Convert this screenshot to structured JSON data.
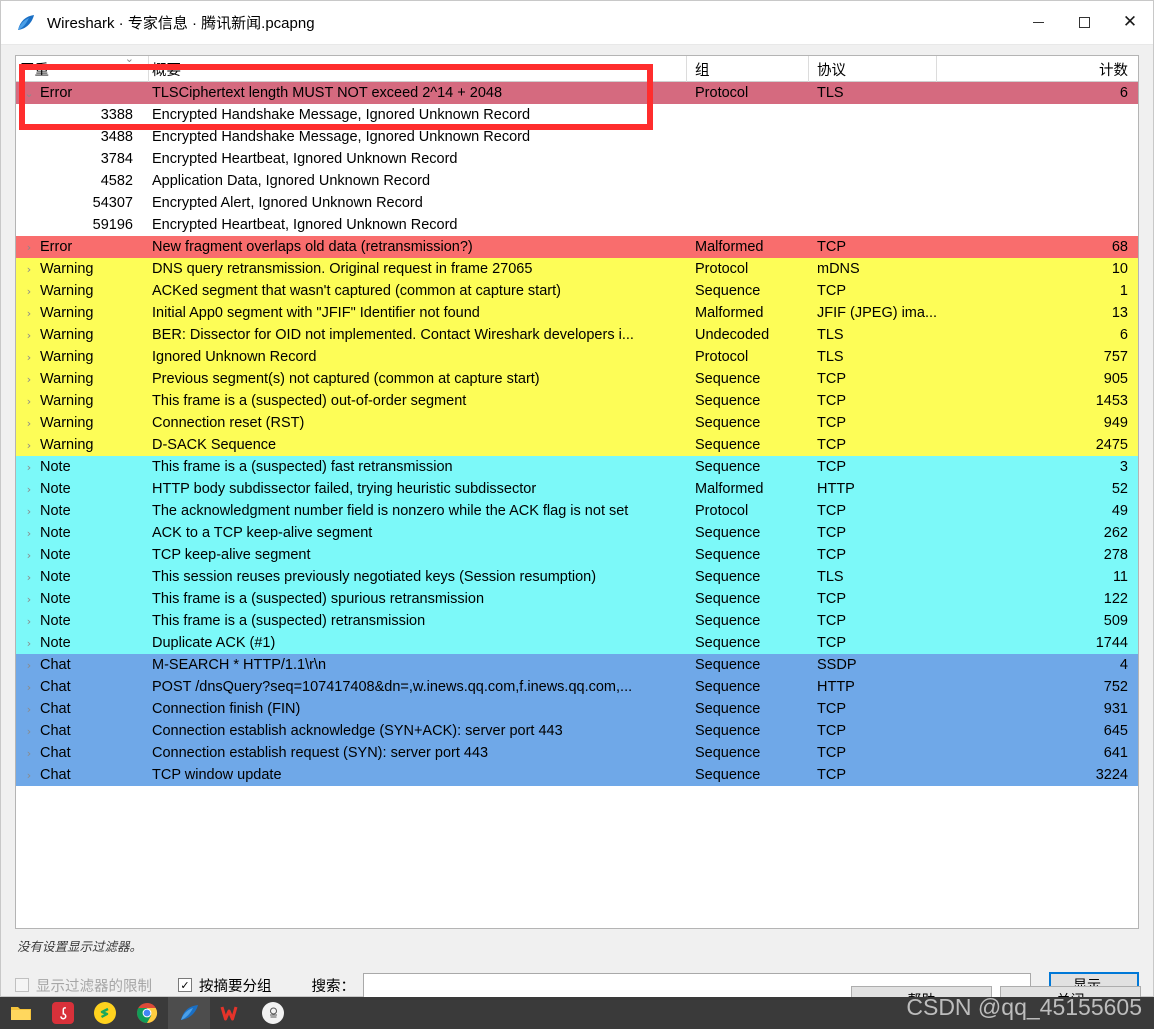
{
  "window": {
    "title": "Wireshark · 专家信息 · 腾讯新闻.pcapng",
    "icon": "wireshark-fin-icon",
    "controls": {
      "minimize": "—",
      "maximize": "□",
      "close": "✕"
    }
  },
  "table": {
    "columns": [
      {
        "key": "severity",
        "label": "严重"
      },
      {
        "key": "summary",
        "label": "概要"
      },
      {
        "key": "group",
        "label": "组"
      },
      {
        "key": "protocol",
        "label": "协议"
      },
      {
        "key": "count",
        "label": "计数"
      }
    ],
    "sort_indicator": "⌄",
    "rows": [
      {
        "twisty": "⌄",
        "severity": "Error",
        "summary": "TLSCiphertext length MUST NOT exceed 2^14 + 2048",
        "group": "Protocol",
        "protocol": "TLS",
        "count": "6",
        "style": "error-selected",
        "child": false
      },
      {
        "twisty": "",
        "severity": "3388",
        "summary": "Encrypted Handshake Message, Ignored Unknown Record",
        "group": "",
        "protocol": "",
        "count": "",
        "style": "child",
        "child": true
      },
      {
        "twisty": "",
        "severity": "3488",
        "summary": "Encrypted Handshake Message, Ignored Unknown Record",
        "group": "",
        "protocol": "",
        "count": "",
        "style": "child",
        "child": true
      },
      {
        "twisty": "",
        "severity": "3784",
        "summary": "Encrypted Heartbeat, Ignored Unknown Record",
        "group": "",
        "protocol": "",
        "count": "",
        "style": "child",
        "child": true
      },
      {
        "twisty": "",
        "severity": "4582",
        "summary": "Application Data, Ignored Unknown Record",
        "group": "",
        "protocol": "",
        "count": "",
        "style": "child",
        "child": true
      },
      {
        "twisty": "",
        "severity": "54307",
        "summary": "Encrypted Alert, Ignored Unknown Record",
        "group": "",
        "protocol": "",
        "count": "",
        "style": "child",
        "child": true
      },
      {
        "twisty": "",
        "severity": "59196",
        "summary": "Encrypted Heartbeat, Ignored Unknown Record",
        "group": "",
        "protocol": "",
        "count": "",
        "style": "child",
        "child": true
      },
      {
        "twisty": "›",
        "severity": "Error",
        "summary": "New fragment overlaps old data (retransmission?)",
        "group": "Malformed",
        "protocol": "TCP",
        "count": "68",
        "style": "error",
        "child": false
      },
      {
        "twisty": "›",
        "severity": "Warning",
        "summary": "DNS query retransmission. Original request in frame 27065",
        "group": "Protocol",
        "protocol": "mDNS",
        "count": "10",
        "style": "warning",
        "child": false
      },
      {
        "twisty": "›",
        "severity": "Warning",
        "summary": "ACKed segment that wasn't captured (common at capture start)",
        "group": "Sequence",
        "protocol": "TCP",
        "count": "1",
        "style": "warning",
        "child": false
      },
      {
        "twisty": "›",
        "severity": "Warning",
        "summary": "Initial App0 segment with \"JFIF\" Identifier not found",
        "group": "Malformed",
        "protocol": "JFIF (JPEG) ima...",
        "count": "13",
        "style": "warning",
        "child": false
      },
      {
        "twisty": "›",
        "severity": "Warning",
        "summary": "BER: Dissector for OID not implemented. Contact Wireshark developers i...",
        "group": "Undecoded",
        "protocol": "TLS",
        "count": "6",
        "style": "warning",
        "child": false
      },
      {
        "twisty": "›",
        "severity": "Warning",
        "summary": "Ignored Unknown Record",
        "group": "Protocol",
        "protocol": "TLS",
        "count": "757",
        "style": "warning",
        "child": false
      },
      {
        "twisty": "›",
        "severity": "Warning",
        "summary": "Previous segment(s) not captured (common at capture start)",
        "group": "Sequence",
        "protocol": "TCP",
        "count": "905",
        "style": "warning",
        "child": false
      },
      {
        "twisty": "›",
        "severity": "Warning",
        "summary": "This frame is a (suspected) out-of-order segment",
        "group": "Sequence",
        "protocol": "TCP",
        "count": "1453",
        "style": "warning",
        "child": false
      },
      {
        "twisty": "›",
        "severity": "Warning",
        "summary": "Connection reset (RST)",
        "group": "Sequence",
        "protocol": "TCP",
        "count": "949",
        "style": "warning",
        "child": false
      },
      {
        "twisty": "›",
        "severity": "Warning",
        "summary": "D-SACK Sequence",
        "group": "Sequence",
        "protocol": "TCP",
        "count": "2475",
        "style": "warning",
        "child": false
      },
      {
        "twisty": "›",
        "severity": "Note",
        "summary": "This frame is a (suspected) fast retransmission",
        "group": "Sequence",
        "protocol": "TCP",
        "count": "3",
        "style": "note",
        "child": false
      },
      {
        "twisty": "›",
        "severity": "Note",
        "summary": "HTTP body subdissector failed, trying heuristic subdissector",
        "group": "Malformed",
        "protocol": "HTTP",
        "count": "52",
        "style": "note",
        "child": false
      },
      {
        "twisty": "›",
        "severity": "Note",
        "summary": "The acknowledgment number field is nonzero while the ACK flag is not set",
        "group": "Protocol",
        "protocol": "TCP",
        "count": "49",
        "style": "note",
        "child": false
      },
      {
        "twisty": "›",
        "severity": "Note",
        "summary": "ACK to a TCP keep-alive segment",
        "group": "Sequence",
        "protocol": "TCP",
        "count": "262",
        "style": "note",
        "child": false
      },
      {
        "twisty": "›",
        "severity": "Note",
        "summary": "TCP keep-alive segment",
        "group": "Sequence",
        "protocol": "TCP",
        "count": "278",
        "style": "note",
        "child": false
      },
      {
        "twisty": "›",
        "severity": "Note",
        "summary": "This session reuses previously negotiated keys (Session resumption)",
        "group": "Sequence",
        "protocol": "TLS",
        "count": "11",
        "style": "note",
        "child": false
      },
      {
        "twisty": "›",
        "severity": "Note",
        "summary": "This frame is a (suspected) spurious retransmission",
        "group": "Sequence",
        "protocol": "TCP",
        "count": "122",
        "style": "note",
        "child": false
      },
      {
        "twisty": "›",
        "severity": "Note",
        "summary": "This frame is a (suspected) retransmission",
        "group": "Sequence",
        "protocol": "TCP",
        "count": "509",
        "style": "note",
        "child": false
      },
      {
        "twisty": "›",
        "severity": "Note",
        "summary": "Duplicate ACK (#1)",
        "group": "Sequence",
        "protocol": "TCP",
        "count": "1744",
        "style": "note",
        "child": false
      },
      {
        "twisty": "›",
        "severity": "Chat",
        "summary": "M-SEARCH * HTTP/1.1\\r\\n",
        "group": "Sequence",
        "protocol": "SSDP",
        "count": "4",
        "style": "chat",
        "child": false
      },
      {
        "twisty": "›",
        "severity": "Chat",
        "summary": "POST /dnsQuery?seq=107417408&dn=,w.inews.qq.com,f.inews.qq.com,...",
        "group": "Sequence",
        "protocol": "HTTP",
        "count": "752",
        "style": "chat",
        "child": false
      },
      {
        "twisty": "›",
        "severity": "Chat",
        "summary": "Connection finish (FIN)",
        "group": "Sequence",
        "protocol": "TCP",
        "count": "931",
        "style": "chat",
        "child": false
      },
      {
        "twisty": "›",
        "severity": "Chat",
        "summary": "Connection establish acknowledge (SYN+ACK): server port 443",
        "group": "Sequence",
        "protocol": "TCP",
        "count": "645",
        "style": "chat",
        "child": false
      },
      {
        "twisty": "›",
        "severity": "Chat",
        "summary": "Connection establish request (SYN): server port 443",
        "group": "Sequence",
        "protocol": "TCP",
        "count": "641",
        "style": "chat",
        "child": false
      },
      {
        "twisty": "›",
        "severity": "Chat",
        "summary": "TCP window update",
        "group": "Sequence",
        "protocol": "TCP",
        "count": "3224",
        "style": "chat",
        "child": false
      }
    ]
  },
  "footer": {
    "filter_note": "没有设置显示过滤器。",
    "limit_checkbox": {
      "label": "显示过滤器的限制",
      "checked": false,
      "enabled": false,
      "mark": ""
    },
    "group_checkbox": {
      "label": "按摘要分组",
      "checked": true,
      "enabled": true,
      "mark": "✓"
    },
    "search_label": "搜索：",
    "search_value": "",
    "search_placeholder": "",
    "show_button": "显示…",
    "help_button": "帮助",
    "close_button": "关闭"
  },
  "watermark": "CSDN @qq_45155605",
  "colors": {
    "error": "#f96d6d",
    "error_selected": "#d56a7f",
    "warning": "#fdfd57",
    "note": "#7cf9f9",
    "chat": "#6fa8e8",
    "annotation": "#ff2d2d",
    "focus": "#0078d7"
  }
}
